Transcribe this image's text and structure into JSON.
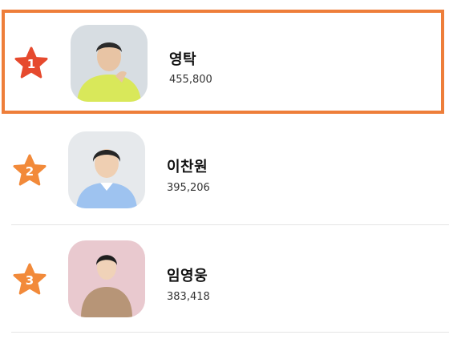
{
  "ranking": {
    "items": [
      {
        "rank": "1",
        "name": "영탁",
        "votes": "455,800",
        "star_color": "#e64a2e",
        "highlighted": true,
        "photo_bg": "#d7dde2",
        "shirt_color": "#d9e85a"
      },
      {
        "rank": "2",
        "name": "이찬원",
        "votes": "395,206",
        "star_color": "#f28a3a",
        "highlighted": false,
        "photo_bg": "#e6e9ec",
        "shirt_color": "#9ec3f0"
      },
      {
        "rank": "3",
        "name": "임영웅",
        "votes": "383,418",
        "star_color": "#f28a3a",
        "highlighted": false,
        "photo_bg": "#e9c9cf",
        "shirt_color": "#b79577"
      }
    ]
  },
  "colors": {
    "highlight_border": "#ee7e3a",
    "divider": "#e4e4e4"
  }
}
